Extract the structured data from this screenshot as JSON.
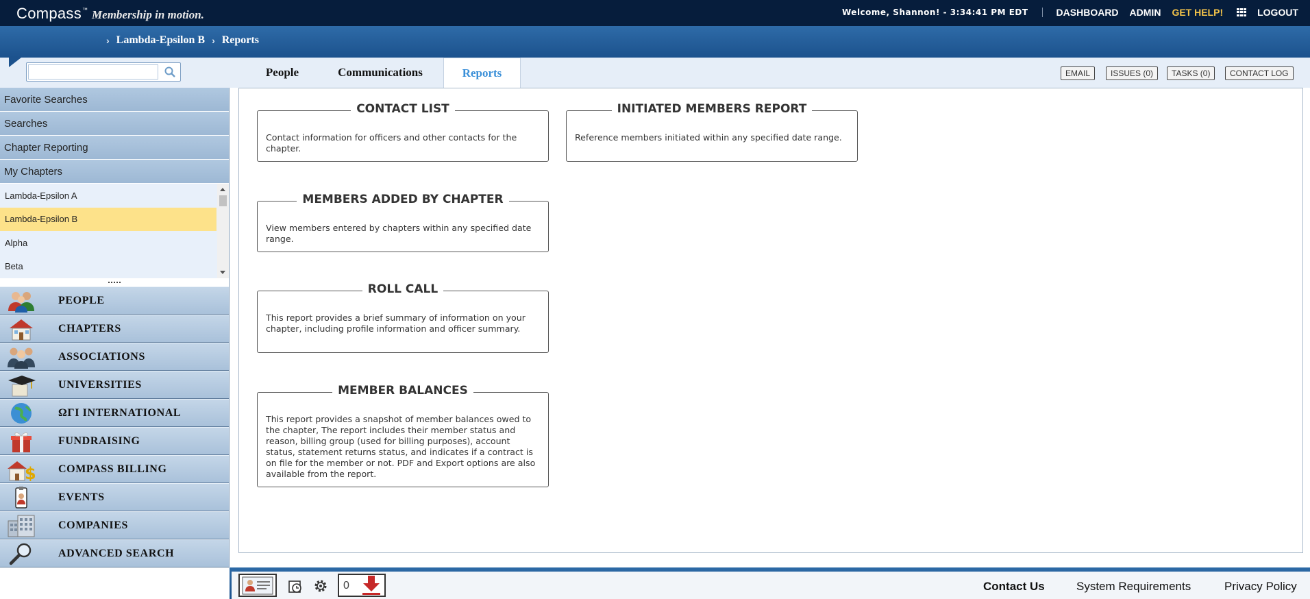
{
  "header": {
    "brand": "Compass",
    "trademark": "™",
    "tagline": "Membership in motion.",
    "welcome": "Welcome, Shannon! - 3:34:41 PM EDT",
    "nav": [
      "DASHBOARD",
      "ADMIN",
      "GET HELP!",
      "LOGOUT"
    ],
    "apps_icon": "grid-icon"
  },
  "breadcrumb": [
    "Lambda-Epsilon B",
    "Reports"
  ],
  "search": {
    "value": "",
    "placeholder": ""
  },
  "tabs": [
    {
      "label": "People",
      "active": false
    },
    {
      "label": "Communications",
      "active": false
    },
    {
      "label": "Reports",
      "active": true
    }
  ],
  "actions": [
    "EMAIL",
    "ISSUES (0)",
    "TASKS (0)",
    "CONTACT LOG"
  ],
  "sidebar": {
    "accordion": [
      "Favorite Searches",
      "Searches",
      "Chapter Reporting",
      "My Chapters"
    ],
    "chapters": [
      "Lambda-Epsilon A",
      "Lambda-Epsilon B",
      "Alpha",
      "Beta"
    ],
    "selected_chapter": "Lambda-Epsilon B",
    "modules": [
      {
        "label": "PEOPLE",
        "icon": "people-icon"
      },
      {
        "label": "CHAPTERS",
        "icon": "house-icon"
      },
      {
        "label": "ASSOCIATIONS",
        "icon": "group-icon"
      },
      {
        "label": "UNIVERSITIES",
        "icon": "graduation-cap-icon"
      },
      {
        "label": "ΩΓΙ INTERNATIONAL",
        "icon": "globe-icon"
      },
      {
        "label": "FUNDRAISING",
        "icon": "gift-icon"
      },
      {
        "label": "COMPASS BILLING",
        "icon": "billing-icon"
      },
      {
        "label": "EVENTS",
        "icon": "badge-icon"
      },
      {
        "label": "COMPANIES",
        "icon": "building-icon"
      },
      {
        "label": "ADVANCED SEARCH",
        "icon": "magnifier-icon"
      }
    ]
  },
  "reports": [
    {
      "title": "CONTACT LIST",
      "desc": "Contact information for officers and other contacts for the chapter."
    },
    {
      "title": "INITIATED MEMBERS REPORT",
      "desc": "Reference members initiated within any specified date range."
    },
    {
      "title": "MEMBERS ADDED BY CHAPTER",
      "desc": "View members entered by chapters within any specified date range."
    },
    {
      "title": "ROLL CALL",
      "desc": "This report provides a brief summary of information on your chapter, including profile information and officer summary."
    },
    {
      "title": "MEMBER BALANCES",
      "desc": "This report provides a snapshot of member balances owed to the chapter, The report includes their member status and reason, billing group (used for billing purposes), account status, statement returns status, and indicates if a contract is on file for the member or not. PDF and Export options are also available from the report."
    }
  ],
  "footer": {
    "download_count": "0",
    "links": [
      "Contact Us",
      "System Requirements",
      "Privacy Policy"
    ]
  }
}
